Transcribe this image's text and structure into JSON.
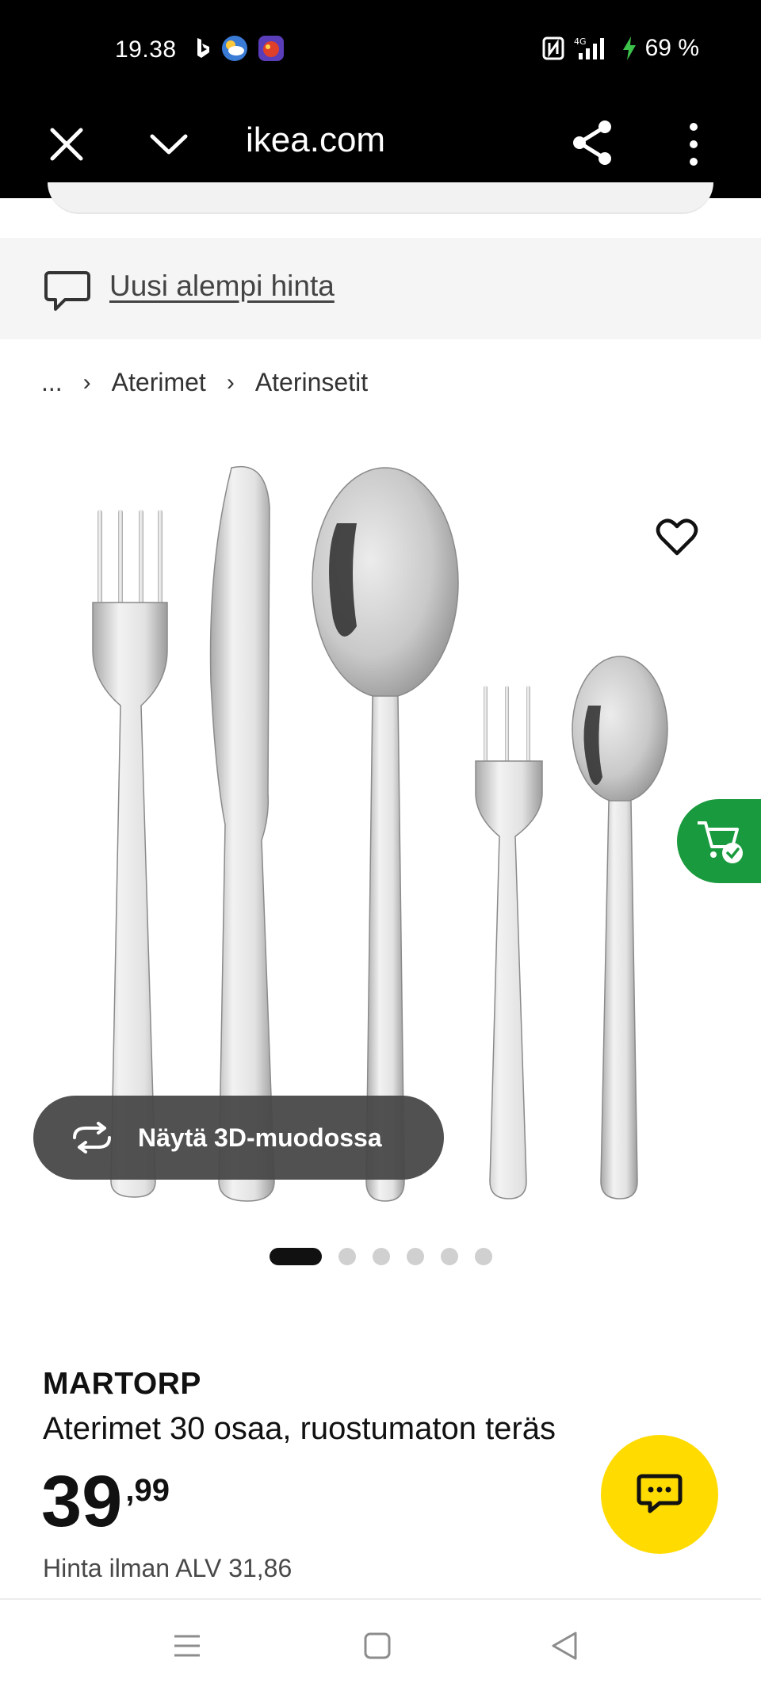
{
  "status_bar": {
    "time": "19.38",
    "network": "4G",
    "battery": "69 %"
  },
  "browser": {
    "domain": "ikea.com"
  },
  "banner": {
    "text": "Uusi alempi hinta"
  },
  "breadcrumb": {
    "ellipsis": "...",
    "items": [
      "Aterimet",
      "Aterinsetit"
    ]
  },
  "gallery": {
    "button_3d_label": "Näytä 3D-muodossa",
    "image_count": 6,
    "active_index": 0
  },
  "product": {
    "brand": "MARTORP",
    "description": "Aterimet 30 osaa, ruostumaton teräs",
    "price_integer": "39",
    "price_decimal": ",99",
    "vat_text": "Hinta ilman ALV 31,86"
  },
  "colors": {
    "cart_green": "#1a9a3e",
    "chat_yellow": "#ffdb00"
  }
}
